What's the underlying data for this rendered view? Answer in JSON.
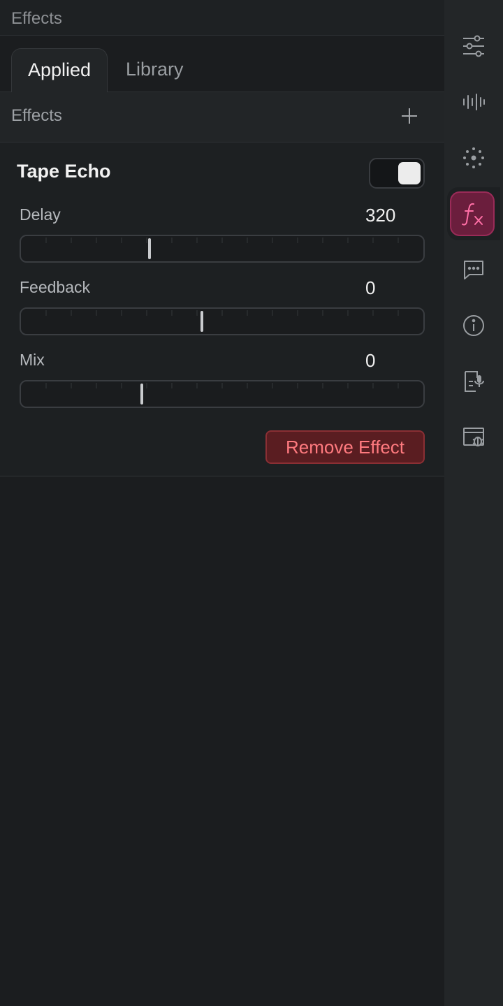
{
  "panel": {
    "title": "Effects"
  },
  "tabs": [
    {
      "label": "Applied",
      "active": true
    },
    {
      "label": "Library",
      "active": false
    }
  ],
  "section": {
    "title": "Effects",
    "add_icon": "plus-icon"
  },
  "effect": {
    "name": "Tape Echo",
    "enabled": true,
    "params": [
      {
        "label": "Delay",
        "value": "320",
        "position": 0.32
      },
      {
        "label": "Feedback",
        "value": "0",
        "position": 0.45
      },
      {
        "label": "Mix",
        "value": "0",
        "position": 0.3
      }
    ],
    "remove_label": "Remove Effect"
  },
  "rail": {
    "items": [
      {
        "icon": "sliders-icon"
      },
      {
        "icon": "waveform-icon"
      },
      {
        "icon": "sparkle-icon"
      },
      {
        "icon": "fx-icon",
        "active": true
      },
      {
        "icon": "chat-icon"
      },
      {
        "icon": "info-icon"
      },
      {
        "icon": "transcript-icon"
      },
      {
        "icon": "debug-icon"
      }
    ]
  },
  "colors": {
    "accent": "#9a2b58",
    "danger": "#ff7a7f",
    "background": "#1b1d1f"
  }
}
